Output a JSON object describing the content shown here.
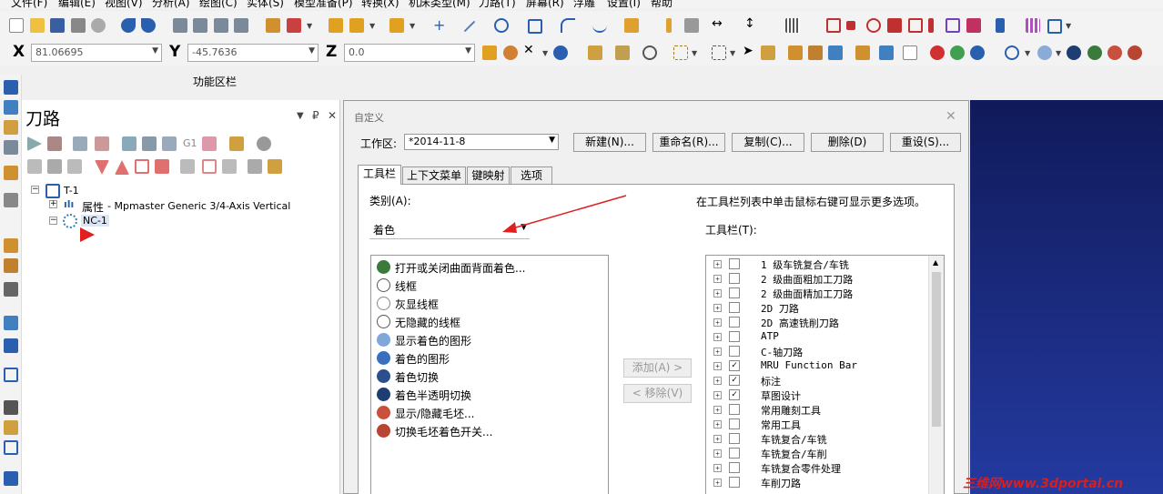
{
  "menu": [
    "文件(F)",
    "编辑(E)",
    "视图(V)",
    "分析(A)",
    "绘图(C)",
    "实体(S)",
    "模型准备(P)",
    "转换(X)",
    "机床类型(M)",
    "刀路(T)",
    "屏幕(R)",
    "浮雕",
    "设置(I)",
    "帮助"
  ],
  "coords": {
    "x_label": "X",
    "x_value": "81.06695",
    "y_label": "Y",
    "y_value": "-45.7636",
    "z_label": "Z",
    "z_value": "0.0"
  },
  "ribbon_label": "功能区栏",
  "panel": {
    "title": "刀路",
    "controls": {
      "dropdown": "▼",
      "pin": "₽",
      "close": "✕"
    },
    "tree": {
      "root": "T-1",
      "properties": "属性",
      "properties_detail": "- Mpmaster Generic 3/4-Axis Vertical",
      "nc": "NC-1"
    }
  },
  "dialog": {
    "title": "自定义",
    "workspace_label": "工作区:",
    "workspace_value": "*2014-11-8",
    "buttons": {
      "new": "新建(N)...",
      "rename": "重命名(R)...",
      "copy": "复制(C)...",
      "delete": "删除(D)",
      "reset": "重设(S)..."
    },
    "tabs": [
      "工具栏",
      "上下文菜单",
      "键映射",
      "选项"
    ],
    "category_label": "类别(A):",
    "category_value": "着色",
    "hint": "在工具栏列表中单击鼠标右键可显示更多选项。",
    "toolbar_label": "工具栏(T):",
    "add": "添加(A) >",
    "remove": "< 移除(V)",
    "commands": [
      {
        "label": "打开或关闭曲面背面着色...",
        "icon": "shade-back-icon",
        "color": "#3a7a3a"
      },
      {
        "label": "线框",
        "icon": "wireframe-icon",
        "color": "#ffffff"
      },
      {
        "label": "灰显线框",
        "icon": "gray-wireframe-icon",
        "color": "#dddddd"
      },
      {
        "label": "无隐藏的线框",
        "icon": "no-hidden-wireframe-icon",
        "color": "#ffffff"
      },
      {
        "label": "显示着色的图形",
        "icon": "shaded-display-icon",
        "color": "#7fa8d8"
      },
      {
        "label": "着色的图形",
        "icon": "shaded-icon",
        "color": "#3a6fc0"
      },
      {
        "label": "着色切换",
        "icon": "shade-toggle-icon",
        "color": "#2a4f8a"
      },
      {
        "label": "着色半透明切换",
        "icon": "translucent-toggle-icon",
        "color": "#1e3d73"
      },
      {
        "label": "显示/隐藏毛坯...",
        "icon": "stock-toggle-icon",
        "color": "#c8503c"
      },
      {
        "label": "切换毛坯着色开关...",
        "icon": "stock-shade-icon",
        "color": "#b84432"
      }
    ],
    "toolbars": [
      {
        "label": "1 级车铣复合/车铣",
        "checked": false
      },
      {
        "label": "2 级曲面粗加工刀路",
        "checked": false
      },
      {
        "label": "2 级曲面精加工刀路",
        "checked": false
      },
      {
        "label": "2D 刀路",
        "checked": false
      },
      {
        "label": "2D 高速铣削刀路",
        "checked": false
      },
      {
        "label": "ATP",
        "checked": false
      },
      {
        "label": "C-轴刀路",
        "checked": false
      },
      {
        "label": "MRU Function Bar",
        "checked": true
      },
      {
        "label": "标注",
        "checked": true
      },
      {
        "label": "草图设计",
        "checked": true
      },
      {
        "label": "常用雕刻工具",
        "checked": false
      },
      {
        "label": "常用工具",
        "checked": false
      },
      {
        "label": "车铣复合/车铣",
        "checked": false
      },
      {
        "label": "车铣复合/车削",
        "checked": false
      },
      {
        "label": "车铣复合零件处理",
        "checked": false
      },
      {
        "label": "车削刀路",
        "checked": false
      }
    ]
  },
  "watermark": "三维网www.3dportal.cn",
  "colors": {
    "accent": "#0a246a",
    "viewport": "#1a2a7a",
    "arrow": "#e02020"
  }
}
